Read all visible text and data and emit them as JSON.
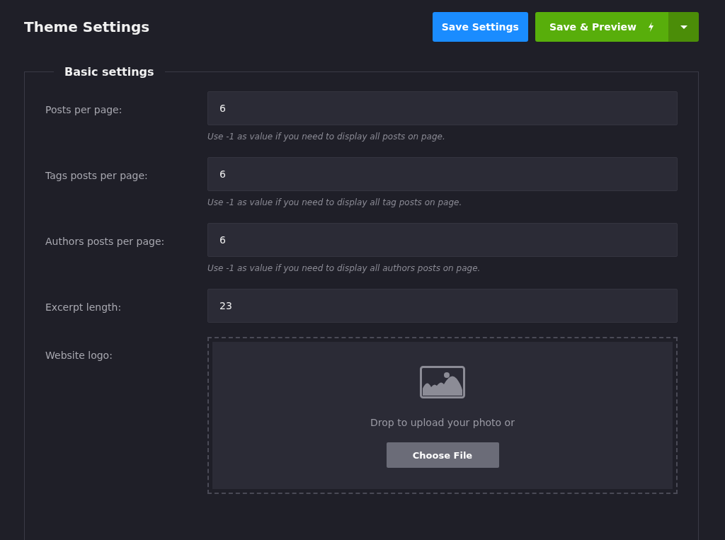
{
  "header": {
    "title": "Theme Settings",
    "buttons": [
      {
        "kind": "primary",
        "label": "Save Settings"
      },
      {
        "kind": "split",
        "label": "Save & Preview"
      }
    ]
  },
  "section": {
    "legend": "Basic settings",
    "fields": [
      {
        "kind": "text",
        "label": "Posts per page:",
        "value": "6",
        "hint": "Use -1 as value if you need to display all posts on page."
      },
      {
        "kind": "text",
        "label": "Tags posts per page:",
        "value": "6",
        "hint": "Use -1 as value if you need to display all tag posts on page."
      },
      {
        "kind": "text",
        "label": "Authors posts per page:",
        "value": "6",
        "hint": "Use -1 as value if you need to display all authors posts on page."
      },
      {
        "kind": "text",
        "label": "Excerpt length:",
        "value": "23"
      },
      {
        "kind": "upload",
        "label": "Website logo:",
        "prompt": "Drop to upload your photo or",
        "button": "Choose File"
      }
    ]
  }
}
